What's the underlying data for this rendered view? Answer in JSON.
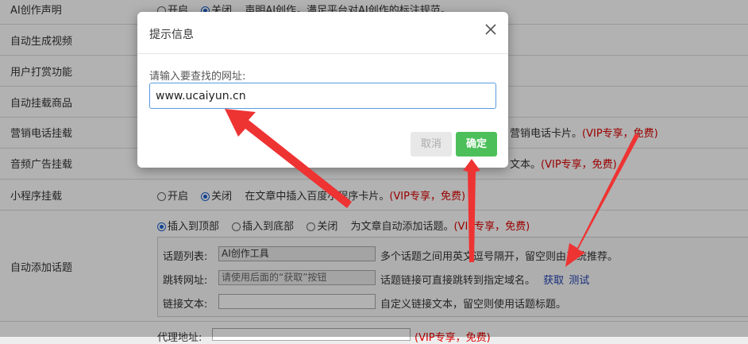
{
  "settings": {
    "rows": [
      {
        "label": "AI创作声明",
        "opt1": "开启",
        "opt2": "关闭",
        "desc": "声明AI创作，满足平台对AI创作的标注规范。"
      },
      {
        "label": "自动生成视频"
      },
      {
        "label": "用户打赏功能"
      },
      {
        "label": "自动挂载商品"
      },
      {
        "label": "营销电话挂载",
        "desc_tail": "营销电话卡片。",
        "vip": "(VIP专享，免费)"
      },
      {
        "label": "音频广告挂载",
        "desc_tail": "文本。",
        "vip": "(VIP专享，免费)"
      },
      {
        "label": "小程序挂载",
        "opt1": "开启",
        "opt2": "关闭",
        "desc": "在文章中插入百度小程序卡片。",
        "vip": "(VIP专享，免费)"
      }
    ],
    "topic": {
      "label": "自动添加话题",
      "opt1": "插入到顶部",
      "opt2": "插入到底部",
      "opt3": "关闭",
      "desc": "为文章自动添加话题。",
      "vip": "(VIP专享，免费)",
      "list_label": "话题列表:",
      "list_value": "AI创作工具",
      "list_desc": "多个话题之间用英文逗号隔开，留空则由系统推荐。",
      "url_label": "跳转网址:",
      "url_value": "请使用后面的“获取”按钮",
      "url_desc": "话题链接可直接跳转到指定域名。",
      "fetch_link": "获取",
      "test_link": "测试",
      "text_label": "链接文本:",
      "text_value": "",
      "text_desc": "自定义链接文本，留空则使用话题标题。"
    },
    "proxy": {
      "label": "代理地址:",
      "vip": "(VIP专享，免费)"
    }
  },
  "dialog": {
    "title": "提示信息",
    "prompt": "请输入要查找的网址:",
    "input_value": "www.ucaiyun.cn",
    "cancel_label": "取消",
    "ok_label": "确定"
  },
  "colors": {
    "vip_red": "#dd0000",
    "link_blue": "#1f3fb0",
    "ok_green": "#4cbf5a",
    "arrow_red": "#ee3333"
  }
}
